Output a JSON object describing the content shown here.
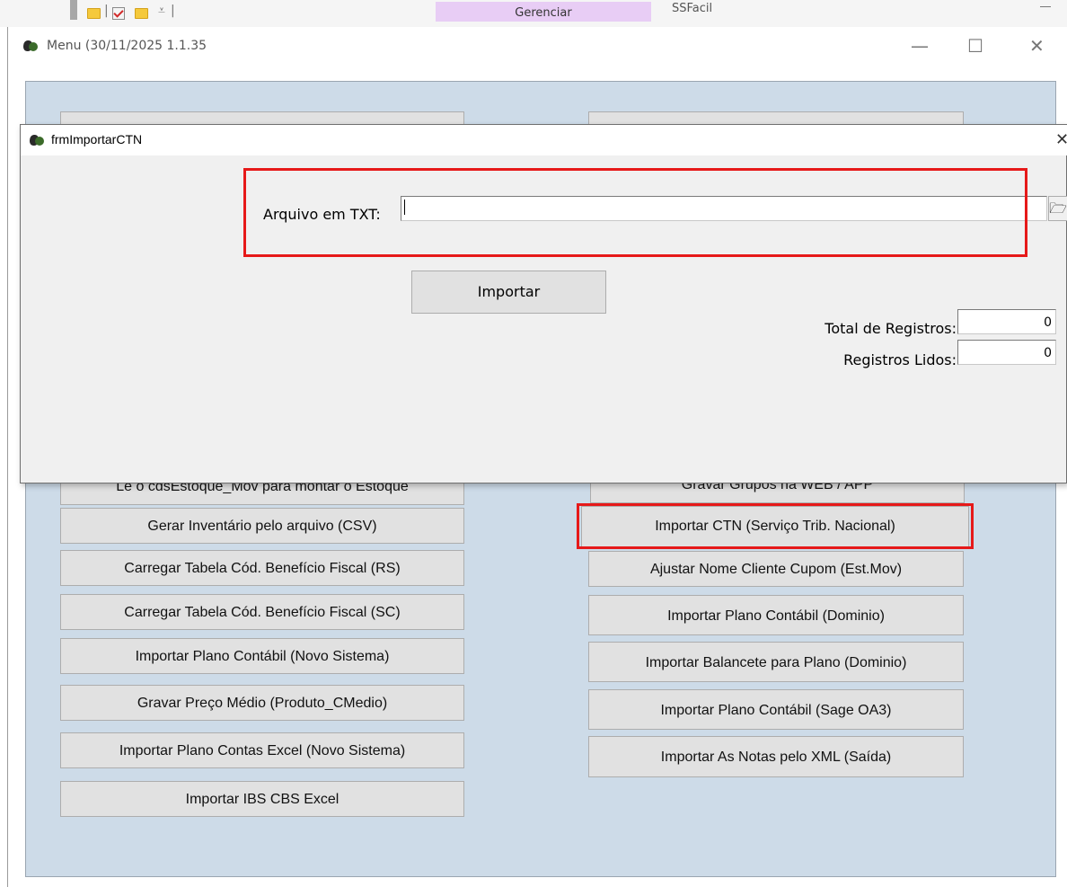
{
  "background_app": {
    "gerenciar_tab": "Gerenciar",
    "app_name": "SSFacil"
  },
  "menu_window": {
    "title": "Menu   (30/11/2025 1.1.35",
    "controls": {
      "minimize": "—",
      "maximize": "☐",
      "close": "✕"
    },
    "left_buttons": [
      "Lê o cdsEstoque_Mov para montar o Estoque",
      "Gerar Inventário pelo arquivo (CSV)",
      "Carregar Tabela Cód. Benefício Fiscal (RS)",
      "Carregar Tabela Cód. Benefício Fiscal (SC)",
      "Importar Plano Contábil (Novo Sistema)",
      "Gravar Preço Médio (Produto_CMedio)",
      "Importar Plano Contas Excel (Novo Sistema)",
      "Importar IBS CBS Excel"
    ],
    "right_buttons": [
      "Gravar Grupos na WEB / APP",
      "Importar CTN (Serviço Trib. Nacional)",
      "Ajustar Nome Cliente Cupom (Est.Mov)",
      "Importar Plano Contábil (Dominio)",
      "Importar Balancete para Plano (Dominio)",
      "Importar Plano Contábil (Sage OA3)",
      "Importar As Notas pelo XML (Saída)"
    ]
  },
  "dialog": {
    "title": "frmImportarCTN",
    "close": "✕",
    "arquivo_label": "Arquivo em TXT:",
    "arquivo_value": "",
    "browse_icon": "folder-open-icon",
    "browse_glyph": "🗁",
    "importar_button": "Importar",
    "total_label": "Total de Registros:",
    "total_value": "0",
    "lidos_label": "Registros Lidos:",
    "lidos_value": "0"
  },
  "colors": {
    "highlight": "#e61919",
    "menu_client_bg": "#cddbe8",
    "button_bg": "#e1e1e1",
    "gerenciar_tab_bg": "#e8cdf5"
  }
}
